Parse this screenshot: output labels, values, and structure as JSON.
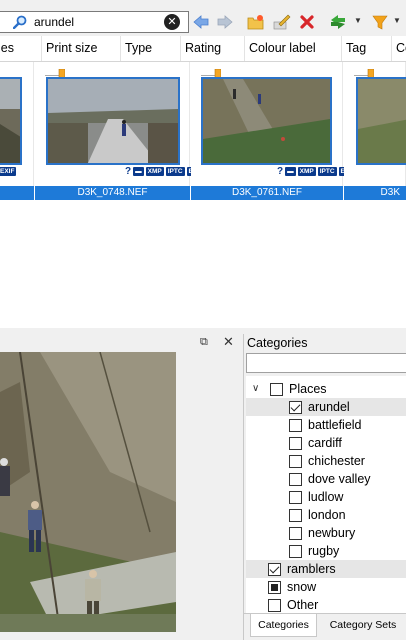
{
  "search": {
    "value": "arundel"
  },
  "columns": [
    "ies",
    "Print size",
    "Type",
    "Rating",
    "Colour label",
    "Tag",
    "Co"
  ],
  "thumbnails": [
    {
      "filename": "",
      "badges": [
        "EXIF"
      ]
    },
    {
      "filename": "D3K_0748.NEF",
      "badges": [
        "XMP",
        "IPTC",
        "EXIF"
      ]
    },
    {
      "filename": "D3K_0761.NEF",
      "badges": [
        "XMP",
        "IPTC",
        "EXIF"
      ]
    },
    {
      "filename": "D3K",
      "badges": []
    }
  ],
  "preview": {
    "pin_icon": "pin-icon",
    "close_icon": "close-icon"
  },
  "categories": {
    "title": "Categories",
    "tree": [
      {
        "label": "Places",
        "state": "unchecked",
        "expanded": true,
        "level": 0
      },
      {
        "label": "arundel",
        "state": "checked",
        "level": 1,
        "selected": true
      },
      {
        "label": "battlefield",
        "state": "unchecked",
        "level": 1
      },
      {
        "label": "cardiff",
        "state": "unchecked",
        "level": 1
      },
      {
        "label": "chichester",
        "state": "unchecked",
        "level": 1
      },
      {
        "label": "dove valley",
        "state": "unchecked",
        "level": 1
      },
      {
        "label": "ludlow",
        "state": "unchecked",
        "level": 1
      },
      {
        "label": "london",
        "state": "unchecked",
        "level": 1
      },
      {
        "label": "newbury",
        "state": "unchecked",
        "level": 1
      },
      {
        "label": "rugby",
        "state": "unchecked",
        "level": 1
      },
      {
        "label": "ramblers",
        "state": "checked",
        "level": 0,
        "selected": true
      },
      {
        "label": "snow",
        "state": "indeterminate",
        "level": 0
      },
      {
        "label": "Other",
        "state": "unchecked",
        "level": 0
      }
    ],
    "tabs": [
      "Categories",
      "Category Sets"
    ]
  },
  "colors": {
    "accent": "#1e7ad8",
    "frame": "#2a72c8"
  }
}
